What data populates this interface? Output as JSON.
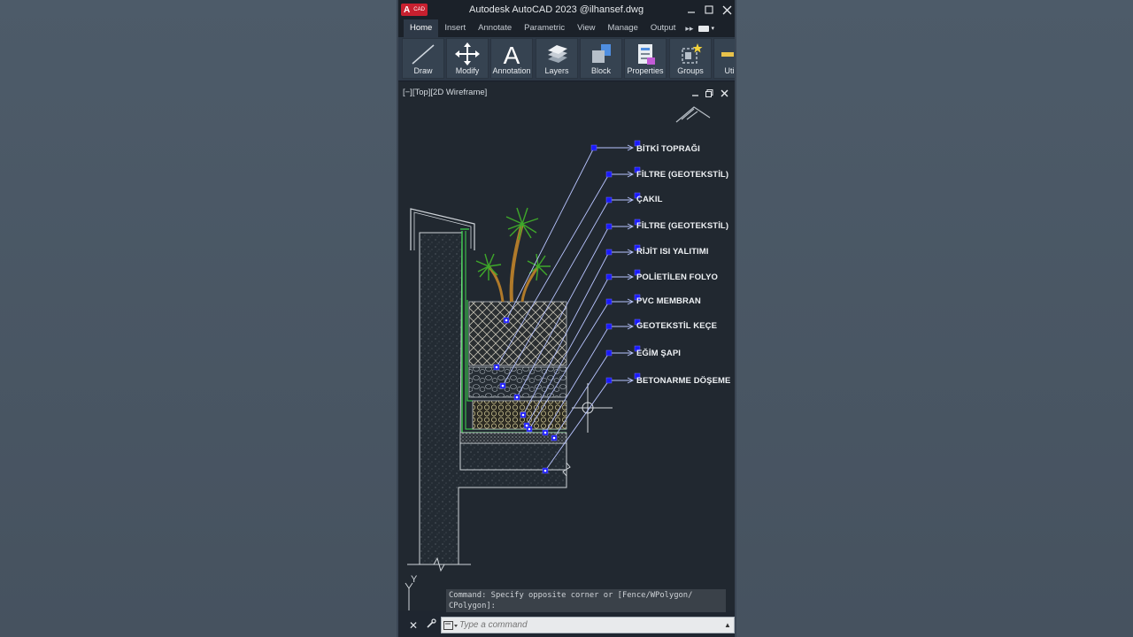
{
  "window": {
    "app_logo": "A",
    "app_logo_sub": "CAD",
    "title": "Autodesk AutoCAD 2023    @ilhansef.dwg",
    "minimize_icon": "minimize-icon",
    "maximize_icon": "maximize-icon",
    "close_icon": "close-icon"
  },
  "menu": {
    "tabs": [
      "Home",
      "Insert",
      "Annotate",
      "Parametric",
      "View",
      "Manage",
      "Output"
    ],
    "active": "Home",
    "more_arrow": "▸▸"
  },
  "ribbon": {
    "buttons": [
      {
        "label": "Draw",
        "icon": "line-draw-icon"
      },
      {
        "label": "Modify",
        "icon": "move-arrows-icon"
      },
      {
        "label": "Annotation",
        "icon": "text-a-icon"
      },
      {
        "label": "Layers",
        "icon": "layers-icon"
      },
      {
        "label": "Block",
        "icon": "block-icon"
      },
      {
        "label": "Properties",
        "icon": "properties-icon"
      },
      {
        "label": "Groups",
        "icon": "groups-icon"
      },
      {
        "label": "Utili",
        "icon": "utilities-icon"
      }
    ]
  },
  "viewport": {
    "label": "[−][Top][2D Wireframe]"
  },
  "callouts": [
    "BİTKİ TOPRAĞI",
    "FİLTRE (GEOTEKSTİL)",
    "ÇAKIL",
    "FİLTRE (GEOTEKSTİL)",
    "RİJİT ISI YALITIMI",
    "POLİETİLEN FOLYO",
    "PVC MEMBRAN",
    "GEOTEKSTİL KEÇE",
    "EĞİM ŞAPI",
    "BETONARME DÖŞEME"
  ],
  "command": {
    "history_line1": "Command: Specify opposite corner or [Fence/WPolygon/",
    "history_line2": "CPolygon]:",
    "placeholder": "Type a command"
  },
  "ucs": {
    "axis_label": "Y"
  },
  "colors": {
    "autocad_red": "#c8202f",
    "canvas": "#212830",
    "grip_blue": "#1a1aff",
    "leader_line": "#b8c4ff",
    "membrane_green": "#3fd94f",
    "plant_green": "#3ea82a"
  }
}
